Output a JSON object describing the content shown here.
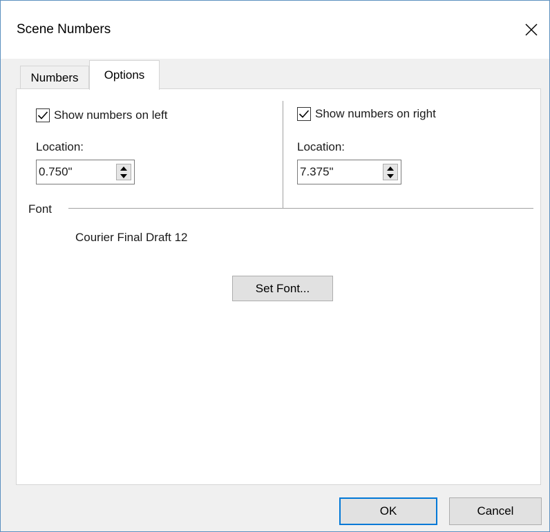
{
  "dialog": {
    "title": "Scene Numbers",
    "close_icon": "close-icon"
  },
  "tabs": [
    {
      "label": "Numbers",
      "active": false
    },
    {
      "label": "Options",
      "active": true
    }
  ],
  "left": {
    "checkbox_label": "Show numbers on left",
    "checked": true,
    "location_label": "Location:",
    "location_value": "0.750\""
  },
  "right": {
    "checkbox_label": "Show numbers on right",
    "checked": true,
    "location_label": "Location:",
    "location_value": "7.375\""
  },
  "font": {
    "group_label": "Font",
    "current_font": "Courier Final Draft 12",
    "set_font_label": "Set Font..."
  },
  "buttons": {
    "ok_label": "OK",
    "cancel_label": "Cancel"
  },
  "colors": {
    "accent": "#0078d7",
    "window_border": "#5b8fbf"
  }
}
